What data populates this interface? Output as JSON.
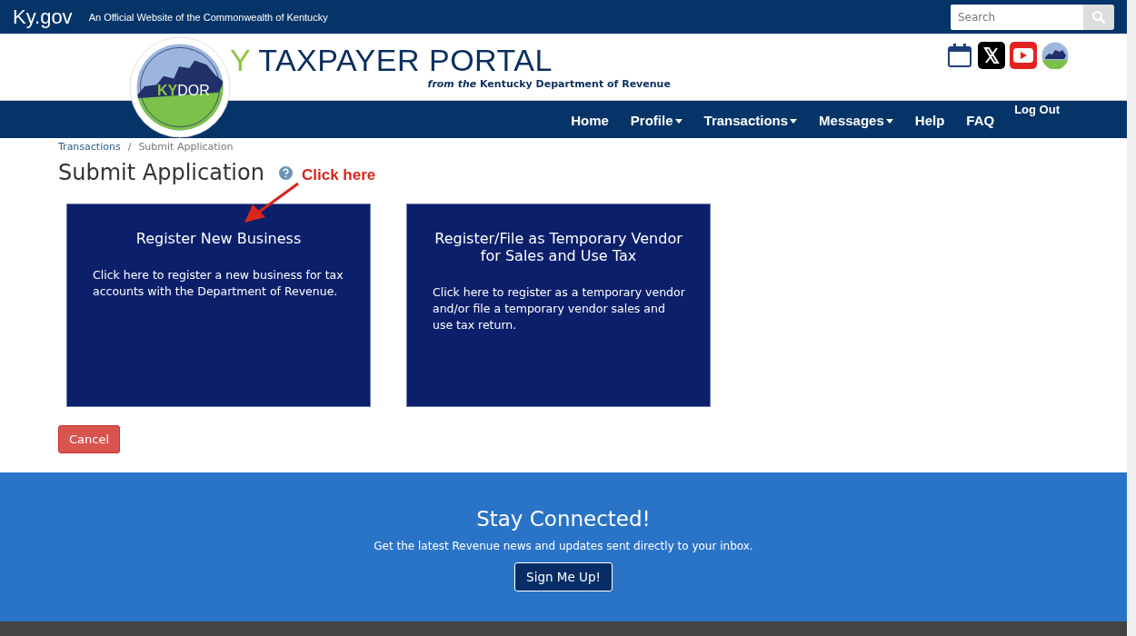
{
  "top_bar": {
    "site": "Ky.gov",
    "tagline": "An Official Website of the Commonwealth of Kentucky",
    "search": {
      "placeholder": "Search"
    }
  },
  "header": {
    "logo": {
      "ky": "KY",
      "dor": "DOR"
    },
    "title_prefix": "Y",
    "title": "TAXPAYER PORTAL",
    "subtitle": "*from the* Kentucky Department of Revenue"
  },
  "nav": {
    "items": [
      {
        "label": "Home",
        "dropdown": false
      },
      {
        "label": "Profile",
        "dropdown": true
      },
      {
        "label": "Transactions",
        "dropdown": true
      },
      {
        "label": "Messages",
        "dropdown": true
      },
      {
        "label": "Help",
        "dropdown": false
      },
      {
        "label": "FAQ",
        "dropdown": false
      }
    ],
    "logout": "Log Out"
  },
  "breadcrumb": {
    "link": "Transactions",
    "separator": "/",
    "current": "Submit Application"
  },
  "page_title": "Submit Application",
  "annotation": "Click here",
  "cards": [
    {
      "title": "Register New Business",
      "text": "Click here to register a new business for tax accounts with the Department of Revenue."
    },
    {
      "title": "Register/File as Temporary Vendor for Sales and Use Tax",
      "text": "Click here to register as a temporary vendor and/or file a temporary vendor sales and use tax return."
    }
  ],
  "cancel_button": "Cancel",
  "footer": {
    "title": "Stay Connected!",
    "text": "Get the latest Revenue news and updates sent directly to your inbox.",
    "button": "Sign Me Up!"
  }
}
